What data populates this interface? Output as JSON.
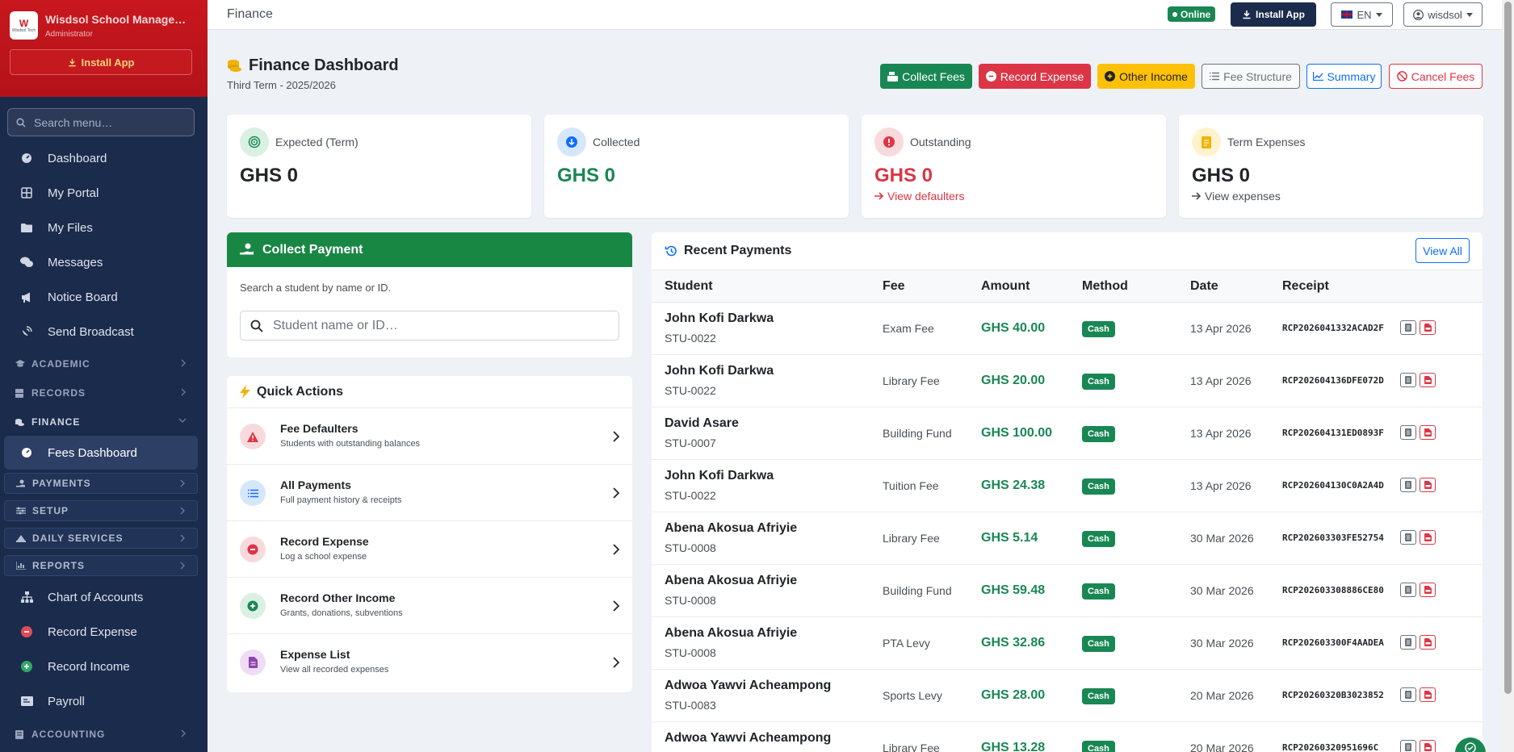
{
  "sidebar": {
    "brand_name": "Wisdsol School Management",
    "role": "Administrator",
    "logo_text": "W",
    "logo_sub": "Wisdsol Tech",
    "install_label": "Install App",
    "search_placeholder": "Search menu…",
    "items": {
      "dashboard": "Dashboard",
      "portal": "My Portal",
      "files": "My Files",
      "messages": "Messages",
      "notice": "Notice Board",
      "broadcast": "Send Broadcast",
      "fees_dashboard": "Fees Dashboard",
      "chart_accounts": "Chart of Accounts",
      "record_expense": "Record Expense",
      "record_income": "Record Income",
      "payroll": "Payroll"
    },
    "sections": {
      "academic": "ACADEMIC",
      "records": "RECORDS",
      "finance": "FINANCE",
      "payments": "PAYMENTS",
      "setup": "SETUP",
      "daily_services": "DAILY SERVICES",
      "reports": "REPORTS",
      "accounting": "ACCOUNTING"
    }
  },
  "topbar": {
    "title": "Finance",
    "online_label": "Online",
    "install_label": "Install App",
    "lang": "EN",
    "user": "wisdsol"
  },
  "header": {
    "title": "Finance Dashboard",
    "subtitle": "Third Term - 2025/2026",
    "buttons": {
      "collect_fees": "Collect Fees",
      "record_expense": "Record Expense",
      "other_income": "Other Income",
      "fee_structure": "Fee Structure",
      "summary": "Summary",
      "cancel_fees": "Cancel Fees"
    }
  },
  "stats": {
    "expected": {
      "label": "Expected (Term)",
      "value": "GHS 0"
    },
    "collected": {
      "label": "Collected",
      "value": "GHS 0"
    },
    "outstanding": {
      "label": "Outstanding",
      "value": "GHS 0",
      "link": "View defaulters"
    },
    "expenses": {
      "label": "Term Expenses",
      "value": "GHS 0",
      "link": "View expenses"
    }
  },
  "collect": {
    "title": "Collect Payment",
    "hint": "Search a student by name or ID.",
    "placeholder": "Student name or ID…"
  },
  "quick_actions": {
    "title": "Quick Actions",
    "items": [
      {
        "title": "Fee Defaulters",
        "desc": "Students with outstanding balances"
      },
      {
        "title": "All Payments",
        "desc": "Full payment history & receipts"
      },
      {
        "title": "Record Expense",
        "desc": "Log a school expense"
      },
      {
        "title": "Record Other Income",
        "desc": "Grants, donations, subventions"
      },
      {
        "title": "Expense List",
        "desc": "View all recorded expenses"
      }
    ]
  },
  "recent": {
    "title": "Recent Payments",
    "view_all": "View All",
    "columns": [
      "Student",
      "Fee",
      "Amount",
      "Method",
      "Date",
      "Receipt"
    ],
    "rows": [
      {
        "name": "John Kofi Darkwa",
        "id": "STU-0022",
        "fee": "Exam Fee",
        "amount": "GHS 40.00",
        "method": "Cash",
        "date": "13 Apr 2026",
        "receipt": "RCP2026041332ACAD2F"
      },
      {
        "name": "John Kofi Darkwa",
        "id": "STU-0022",
        "fee": "Library Fee",
        "amount": "GHS 20.00",
        "method": "Cash",
        "date": "13 Apr 2026",
        "receipt": "RCP202604136DFE072D"
      },
      {
        "name": "David Asare",
        "id": "STU-0007",
        "fee": "Building Fund",
        "amount": "GHS 100.00",
        "method": "Cash",
        "date": "13 Apr 2026",
        "receipt": "RCP202604131ED0893F"
      },
      {
        "name": "John Kofi Darkwa",
        "id": "STU-0022",
        "fee": "Tuition Fee",
        "amount": "GHS 24.38",
        "method": "Cash",
        "date": "13 Apr 2026",
        "receipt": "RCP202604130C0A2A4D"
      },
      {
        "name": "Abena Akosua Afriyie",
        "id": "STU-0008",
        "fee": "Library Fee",
        "amount": "GHS 5.14",
        "method": "Cash",
        "date": "30 Mar 2026",
        "receipt": "RCP202603303FE52754"
      },
      {
        "name": "Abena Akosua Afriyie",
        "id": "STU-0008",
        "fee": "Building Fund",
        "amount": "GHS 59.48",
        "method": "Cash",
        "date": "30 Mar 2026",
        "receipt": "RCP202603308886CE80"
      },
      {
        "name": "Abena Akosua Afriyie",
        "id": "STU-0008",
        "fee": "PTA Levy",
        "amount": "GHS 32.86",
        "method": "Cash",
        "date": "30 Mar 2026",
        "receipt": "RCP202603300F4AADEA"
      },
      {
        "name": "Adwoa Yawvi Acheampong",
        "id": "STU-0083",
        "fee": "Sports Levy",
        "amount": "GHS 28.00",
        "method": "Cash",
        "date": "20 Mar 2026",
        "receipt": "RCP20260320B3023852"
      },
      {
        "name": "Adwoa Yawvi Acheampong",
        "id": "",
        "fee": "Library Fee",
        "amount": "GHS 13.28",
        "method": "Cash",
        "date": "20 Mar 2026",
        "receipt": "RCP20260320951696C"
      }
    ]
  },
  "colors": {
    "brand_red": "#c8171e",
    "sidebar": "#1b2b4b",
    "success": "#198754",
    "danger": "#dc3545",
    "primary": "#0d6efd",
    "warning": "#ffc107"
  }
}
